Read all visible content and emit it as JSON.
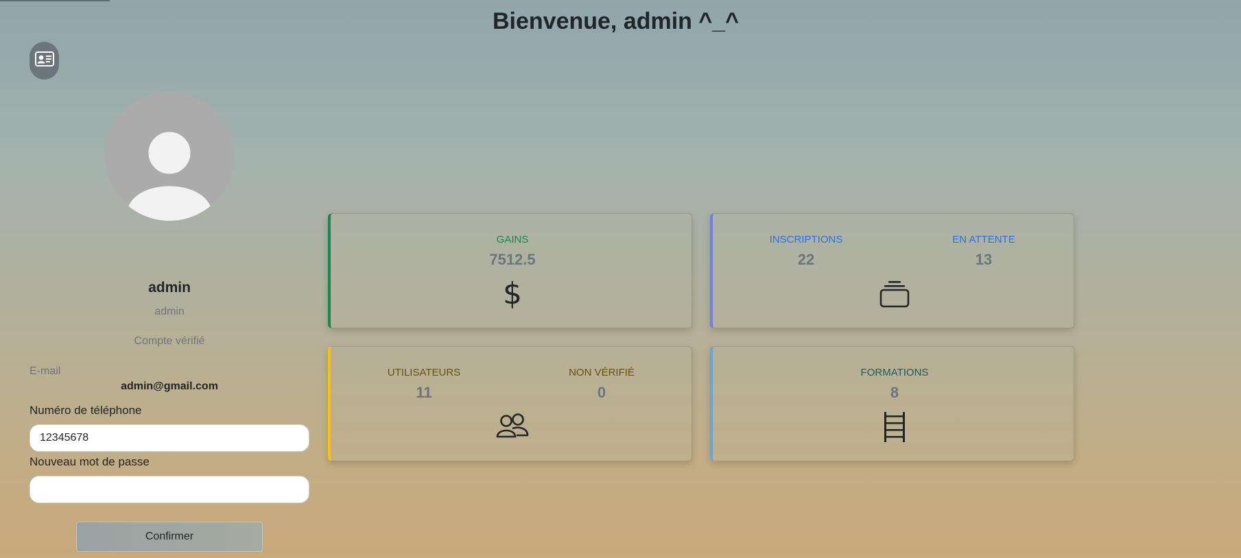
{
  "header": {
    "title": "Bienvenue, admin ^_^"
  },
  "profile": {
    "id_card_icon": "person-vcard-icon",
    "avatar_icon": "person-avatar-icon",
    "name": "admin",
    "role": "admin",
    "status": "Compte vérifié",
    "email_label": "E-mail",
    "email": "admin@gmail.com",
    "phone_label": "Numéro de téléphone",
    "phone_value": "12345678",
    "password_label": "Nouveau mot de passe",
    "password_value": "",
    "confirm_label": "Confirmer"
  },
  "stats": {
    "gains": {
      "label": "GAINS",
      "value": "7512.5",
      "icon": "currency-dollar-icon",
      "label_color": "#198754",
      "accent": "#198754"
    },
    "inscriptions": {
      "label": "INSCRIPTIONS",
      "value": "22",
      "pending_label": "EN ATTENTE",
      "pending_value": "13",
      "icon": "collection-icon",
      "label_color": "#2f6fe0",
      "accent": "#6f7fe8"
    },
    "utilisateurs": {
      "label": "UTILISATEURS",
      "value": "11",
      "unverified_label": "NON VÉRIFIÉ",
      "unverified_value": "0",
      "icon": "people-icon",
      "label_color": "#6b4f0a",
      "accent": "#ffc107"
    },
    "formations": {
      "label": "FORMATIONS",
      "value": "8",
      "icon": "ladder-icon",
      "label_color": "#1e5a5a",
      "accent": "#6aa3d6"
    }
  }
}
